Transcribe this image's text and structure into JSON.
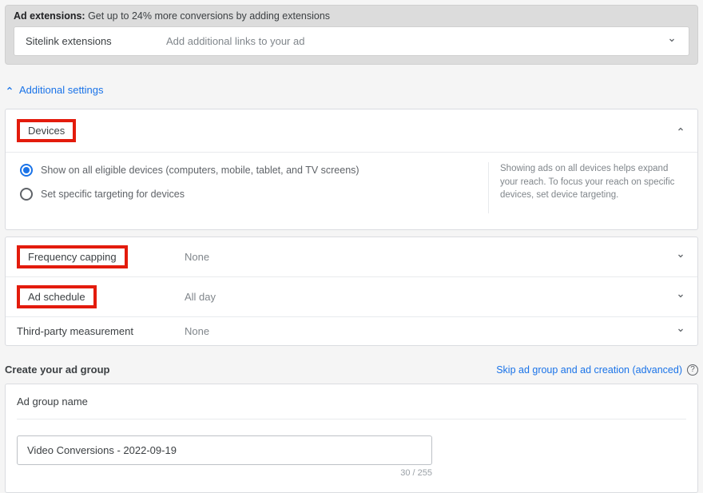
{
  "adExtensions": {
    "title_bold": "Ad extensions:",
    "title_rest": " Get up to 24% more conversions by adding extensions",
    "row_label": "Sitelink extensions",
    "row_desc": "Add additional links to your ad"
  },
  "additionalSettingsLabel": "Additional settings",
  "devices": {
    "title": "Devices",
    "option_all": "Show on all eligible devices (computers, mobile, tablet, and TV screens)",
    "option_specific": "Set specific targeting for devices",
    "help_text": "Showing ads on all devices helps expand your reach. To focus your reach on specific devices, set device targeting."
  },
  "rows": {
    "frequency_capping": {
      "title": "Frequency capping",
      "value": "None"
    },
    "ad_schedule": {
      "title": "Ad schedule",
      "value": "All day"
    },
    "third_party": {
      "title": "Third-party measurement",
      "value": "None"
    }
  },
  "adGroup": {
    "create_title": "Create your ad group",
    "skip_text": "Skip ad group and ad creation (advanced)",
    "name_label": "Ad group name",
    "name_value": "Video Conversions - 2022-09-19",
    "char_count": "30 / 255"
  }
}
